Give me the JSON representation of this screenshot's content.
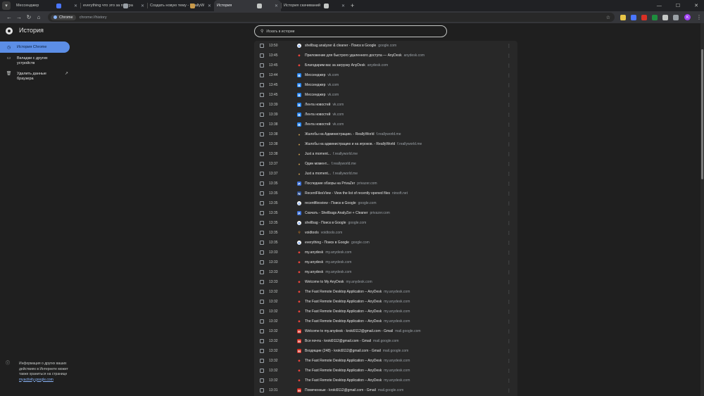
{
  "tabs": [
    {
      "title": "Мессенджер",
      "favicon_color": "#4a76ff",
      "active": false
    },
    {
      "title": "everything что это за програ",
      "favicon_color": "#9aa0a6",
      "active": false
    },
    {
      "title": "Создать новую тему - ReallyW",
      "favicon_color": "#c99a4a",
      "active": false
    },
    {
      "title": "История",
      "favicon_color": "#c4c7c5",
      "active": true
    },
    {
      "title": "История скачиваний",
      "favicon_color": "#c4c7c5",
      "active": false
    }
  ],
  "toolbar": {
    "chip_label": "Chrome",
    "url": "chrome://history",
    "avatar_letter": "K",
    "extension_colors": [
      "#e8c547",
      "#4a76ff",
      "#d93025",
      "#1e8e3e",
      "#c4c7c5",
      "#9aa0a6"
    ]
  },
  "page": {
    "title": "История",
    "search_placeholder": "Искать в истории"
  },
  "sidebar": {
    "items": [
      {
        "label": "История Chrome"
      },
      {
        "label": "Вкладки с других устройств"
      },
      {
        "label": "Удалить данные браузера"
      }
    ],
    "footer_text": "Информация о других ваших действиях в Интернете может также храниться на странице",
    "footer_link": "myactivity.google.com"
  },
  "history": [
    {
      "time": "13:50",
      "title": "shellbag analyzer & cleaner - Поиск в Google",
      "domain": "google.com",
      "icon": "google"
    },
    {
      "time": "13:45",
      "title": "Приложение для быстрого удаленного доступа — AnyDesk",
      "domain": "anydesk.com",
      "icon": "anydesk"
    },
    {
      "time": "13:45",
      "title": "Благодарим вас за загрузку AnyDesk",
      "domain": "anydesk.com",
      "icon": "anydesk"
    },
    {
      "time": "13:44",
      "title": "Мессенджер",
      "domain": "vk.com",
      "icon": "vk"
    },
    {
      "time": "13:45",
      "title": "Мессенджер",
      "domain": "vk.com",
      "icon": "vk"
    },
    {
      "time": "13:45",
      "title": "Мессенджер",
      "domain": "vk.com",
      "icon": "vk"
    },
    {
      "time": "13:39",
      "title": "Лента новостей",
      "domain": "vk.com",
      "icon": "vk"
    },
    {
      "time": "13:39",
      "title": "Лента новостей",
      "domain": "vk.com",
      "icon": "vk"
    },
    {
      "time": "13:38",
      "title": "Лента новостей",
      "domain": "vk.com",
      "icon": "vk"
    },
    {
      "time": "13:38",
      "title": "Жалобы на Администрацию. - ReallyWorld",
      "domain": "f.reallyworld.me",
      "icon": "rw"
    },
    {
      "time": "13:38",
      "title": "Жалобы на администрацию и на игроков. - ReallyWorld",
      "domain": "f.reallyworld.me",
      "icon": "rw"
    },
    {
      "time": "13:38",
      "title": "Just a moment...",
      "domain": "f.reallyworld.me",
      "icon": "rw"
    },
    {
      "time": "13:37",
      "title": "Один момент...",
      "domain": "f.reallyworld.me",
      "icon": "rw"
    },
    {
      "time": "13:37",
      "title": "Just a moment...",
      "domain": "f.reallyworld.me",
      "icon": "rw"
    },
    {
      "time": "13:35",
      "title": "Последние обзоры на PrivaZer",
      "domain": "privazer.com",
      "icon": "privazer"
    },
    {
      "time": "13:35",
      "title": "RecentFilesView - View the list of recently opened files",
      "domain": "nirsoft.net",
      "icon": "nirsoft"
    },
    {
      "time": "13:35",
      "title": "recentfilesview - Поиск в Google",
      "domain": "google.com",
      "icon": "google"
    },
    {
      "time": "13:35",
      "title": "Скачать - Shellbags AnalyZer + Cleaner",
      "domain": "privazer.com",
      "icon": "privazer"
    },
    {
      "time": "13:35",
      "title": "shellbag - Поиск в Google",
      "domain": "google.com",
      "icon": "google"
    },
    {
      "time": "13:35",
      "title": "voidtools",
      "domain": "voidtools.com",
      "icon": "voidtools"
    },
    {
      "time": "13:35",
      "title": "everything - Поиск в Google",
      "domain": "google.com",
      "icon": "google"
    },
    {
      "time": "13:33",
      "title": "my.anydesk",
      "domain": "my.anydesk.com",
      "icon": "anydesk"
    },
    {
      "time": "13:33",
      "title": "my.anydesk",
      "domain": "my.anydesk.com",
      "icon": "anydesk"
    },
    {
      "time": "13:33",
      "title": "my.anydesk",
      "domain": "my.anydesk.com",
      "icon": "anydesk"
    },
    {
      "time": "13:33",
      "title": "Welcome to My AnyDesk",
      "domain": "my.anydesk.com",
      "icon": "anydesk"
    },
    {
      "time": "13:32",
      "title": "The Fast Remote Desktop Application – AnyDesk",
      "domain": "my.anydesk.com",
      "icon": "anydesk"
    },
    {
      "time": "13:32",
      "title": "The Fast Remote Desktop Application – AnyDesk",
      "domain": "my.anydesk.com",
      "icon": "anydesk"
    },
    {
      "time": "13:32",
      "title": "The Fast Remote Desktop Application – AnyDesk",
      "domain": "my.anydesk.com",
      "icon": "anydesk"
    },
    {
      "time": "13:32",
      "title": "The Fast Remote Desktop Application – AnyDesk",
      "domain": "my.anydesk.com",
      "icon": "anydesk"
    },
    {
      "time": "13:32",
      "title": "Welcome to my.anydesk - kroki9112@gmail.com - Gmail",
      "domain": "mail.google.com",
      "icon": "gmail"
    },
    {
      "time": "13:32",
      "title": "Вся почта - kroki9112@gmail.com - Gmail",
      "domain": "mail.google.com",
      "icon": "gmail"
    },
    {
      "time": "13:32",
      "title": "Входящие (248) - kroki9112@gmail.com - Gmail",
      "domain": "mail.google.com",
      "icon": "gmail"
    },
    {
      "time": "13:32",
      "title": "The Fast Remote Desktop Application – AnyDesk",
      "domain": "my.anydesk.com",
      "icon": "anydesk"
    },
    {
      "time": "13:32",
      "title": "The Fast Remote Desktop Application – AnyDesk",
      "domain": "my.anydesk.com",
      "icon": "anydesk"
    },
    {
      "time": "13:32",
      "title": "The Fast Remote Desktop Application – AnyDesk",
      "domain": "my.anydesk.com",
      "icon": "anydesk"
    },
    {
      "time": "13:31",
      "title": "Помеченные - kroki9112@gmail.com - Gmail",
      "domain": "mail.google.com",
      "icon": "gmail"
    }
  ],
  "icon_colors": {
    "google": "#ffffff",
    "anydesk": "#ef443b",
    "vk": "#2787f5",
    "rw": "#c99a4a",
    "privazer": "#3b6fd8",
    "nirsoft": "#2a4d8f",
    "voidtools": "#f08a24",
    "gmail": "#d93025"
  }
}
